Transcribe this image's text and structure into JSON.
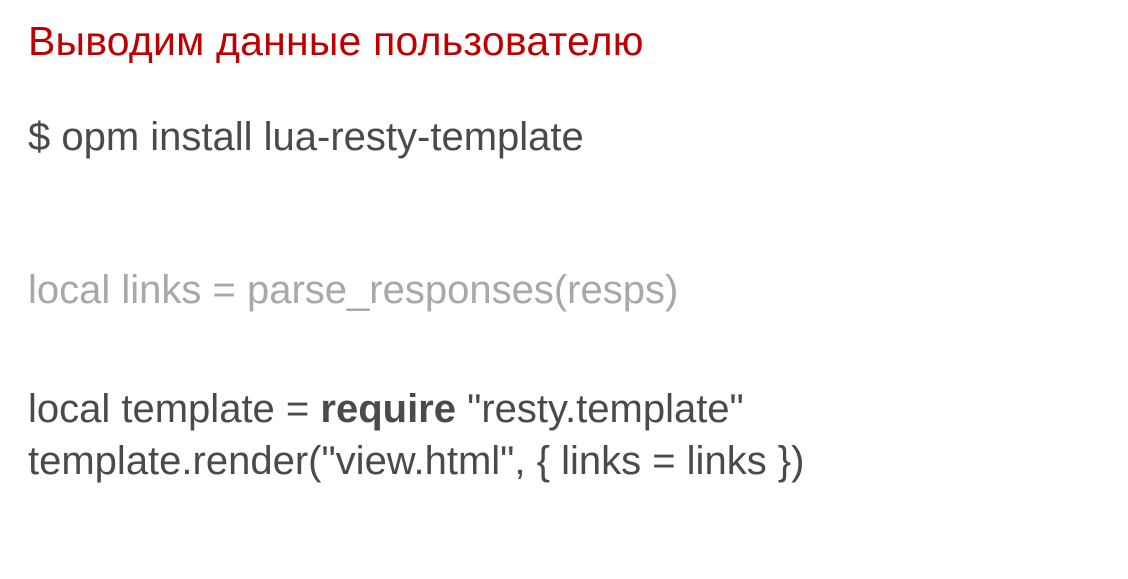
{
  "title": "Выводим данные пользователю",
  "install_command": "$ opm install lua-resty-template",
  "code": {
    "faded_line": "local links = parse_responses(resps)",
    "line1_prefix": "local template = ",
    "line1_keyword": "require",
    "line1_suffix": " \"resty.template\"",
    "line2": "template.render(\"view.html\", { links = links })"
  }
}
